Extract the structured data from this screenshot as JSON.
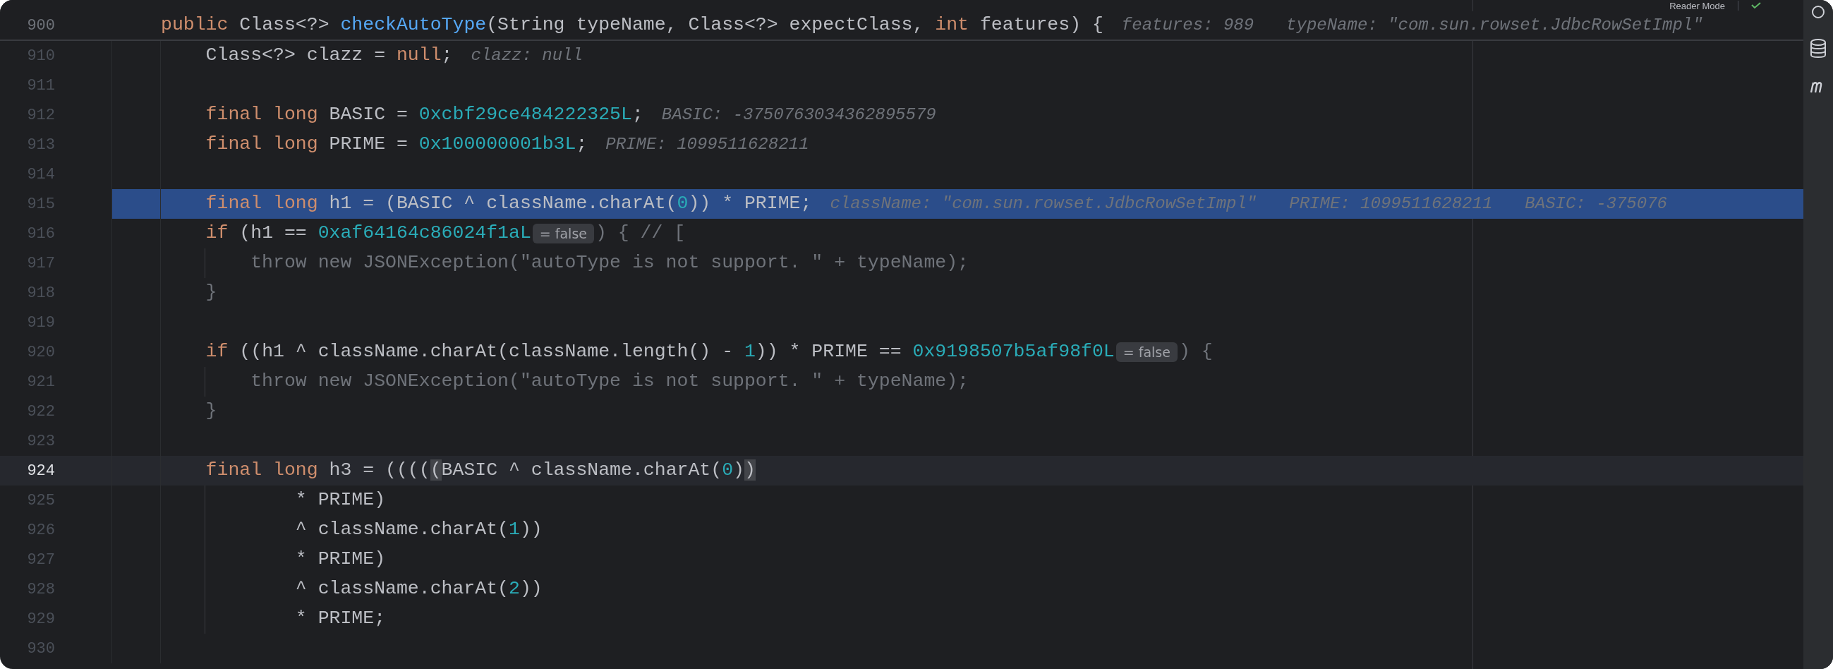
{
  "toolbar": {
    "reader_mode": "Reader Mode"
  },
  "sticky_line": {
    "number": "900",
    "tokens": [
      {
        "kind": "keyword",
        "text": "public"
      },
      {
        "kind": "plain",
        "text": " Class<?> "
      },
      {
        "kind": "function",
        "text": "checkAutoType"
      },
      {
        "kind": "plain",
        "text": "(String typeName, Class<?> expectClass, "
      },
      {
        "kind": "keyword",
        "text": "int"
      },
      {
        "kind": "plain",
        "text": " features) {"
      },
      {
        "kind": "hint",
        "text": "features: 989"
      },
      {
        "kind": "hint",
        "text": "typeName: \"com.sun.rowset.JdbcRowSetImpl\""
      }
    ]
  },
  "lines": [
    {
      "number": "910",
      "selected": false,
      "current": false,
      "guide": false,
      "tokens": [
        {
          "kind": "plain",
          "text": "    Class<?> clazz = "
        },
        {
          "kind": "keyword",
          "text": "null"
        },
        {
          "kind": "plain",
          "text": ";"
        },
        {
          "kind": "hint",
          "text": "clazz: null"
        }
      ]
    },
    {
      "number": "911",
      "selected": false,
      "current": false,
      "guide": false
    },
    {
      "number": "912",
      "selected": false,
      "current": false,
      "guide": false,
      "tokens": [
        {
          "kind": "keyword",
          "text": "    final long"
        },
        {
          "kind": "plain",
          "text": " BASIC = "
        },
        {
          "kind": "number",
          "text": "0xcbf29ce484222325L"
        },
        {
          "kind": "plain",
          "text": ";"
        },
        {
          "kind": "hint",
          "text": "BASIC: -3750763034362895579"
        }
      ]
    },
    {
      "number": "913",
      "selected": false,
      "current": false,
      "guide": false,
      "tokens": [
        {
          "kind": "keyword",
          "text": "    final long"
        },
        {
          "kind": "plain",
          "text": " PRIME = "
        },
        {
          "kind": "number",
          "text": "0x100000001b3L"
        },
        {
          "kind": "plain",
          "text": ";"
        },
        {
          "kind": "hint",
          "text": "PRIME: 1099511628211"
        }
      ]
    },
    {
      "number": "914",
      "selected": false,
      "current": false,
      "guide": false
    },
    {
      "number": "915",
      "selected": true,
      "current": false,
      "guide": false,
      "tokens": [
        {
          "kind": "keyword",
          "text": "    final long"
        },
        {
          "kind": "plain",
          "text": " h1 = (BASIC ^ className.charAt("
        },
        {
          "kind": "number",
          "text": "0"
        },
        {
          "kind": "plain",
          "text": ")) * PRIME;"
        },
        {
          "kind": "hint",
          "text": "className: \"com.sun.rowset.JdbcRowSetImpl\""
        },
        {
          "kind": "hint",
          "text": "PRIME: 1099511628211"
        },
        {
          "kind": "hint",
          "text": "BASIC: -375076"
        }
      ]
    },
    {
      "number": "916",
      "selected": false,
      "current": false,
      "guide": false,
      "tokens": [
        {
          "kind": "keyword",
          "text": "    if"
        },
        {
          "kind": "plain",
          "text": " (h1 == "
        },
        {
          "kind": "number",
          "text": "0xaf64164c86024f1aL"
        },
        {
          "kind": "inlay",
          "text": "= false"
        },
        {
          "kind": "dim",
          "text": ") { // ["
        }
      ]
    },
    {
      "number": "917",
      "selected": false,
      "current": false,
      "guide": true,
      "tokens": [
        {
          "kind": "dim",
          "text": "        throw new JSONException(\"autoType is not support. \" + typeName);"
        }
      ]
    },
    {
      "number": "918",
      "selected": false,
      "current": false,
      "guide": false,
      "tokens": [
        {
          "kind": "dim",
          "text": "    }"
        }
      ]
    },
    {
      "number": "919",
      "selected": false,
      "current": false,
      "guide": false
    },
    {
      "number": "920",
      "selected": false,
      "current": false,
      "guide": false,
      "tokens": [
        {
          "kind": "keyword",
          "text": "    if"
        },
        {
          "kind": "plain",
          "text": " ((h1 ^ className.charAt(className.length() - "
        },
        {
          "kind": "number",
          "text": "1"
        },
        {
          "kind": "plain",
          "text": ")) * PRIME == "
        },
        {
          "kind": "number",
          "text": "0x9198507b5af98f0L"
        },
        {
          "kind": "inlay",
          "text": "= false"
        },
        {
          "kind": "dim",
          "text": ") {"
        }
      ]
    },
    {
      "number": "921",
      "selected": false,
      "current": false,
      "guide": true,
      "tokens": [
        {
          "kind": "dim",
          "text": "        throw new JSONException(\"autoType is not support. \" + typeName);"
        }
      ]
    },
    {
      "number": "922",
      "selected": false,
      "current": false,
      "guide": false,
      "tokens": [
        {
          "kind": "dim",
          "text": "    }"
        }
      ]
    },
    {
      "number": "923",
      "selected": false,
      "current": false,
      "guide": false
    },
    {
      "number": "924",
      "selected": false,
      "current": true,
      "guide": false,
      "tokens": [
        {
          "kind": "keyword",
          "text": "    final long"
        },
        {
          "kind": "plain",
          "text": " h3 = (((("
        },
        {
          "kind": "match",
          "text": "("
        },
        {
          "kind": "plain",
          "text": "BASIC ^ className.charAt("
        },
        {
          "kind": "number",
          "text": "0"
        },
        {
          "kind": "plain",
          "text": ")"
        },
        {
          "kind": "match",
          "text": ")"
        }
      ]
    },
    {
      "number": "925",
      "selected": false,
      "current": false,
      "guide": true,
      "tokens": [
        {
          "kind": "plain",
          "text": "            * PRIME)"
        }
      ]
    },
    {
      "number": "926",
      "selected": false,
      "current": false,
      "guide": true,
      "tokens": [
        {
          "kind": "plain",
          "text": "            ^ className.charAt("
        },
        {
          "kind": "number",
          "text": "1"
        },
        {
          "kind": "plain",
          "text": "))"
        }
      ]
    },
    {
      "number": "927",
      "selected": false,
      "current": false,
      "guide": true,
      "tokens": [
        {
          "kind": "plain",
          "text": "            * PRIME)"
        }
      ]
    },
    {
      "number": "928",
      "selected": false,
      "current": false,
      "guide": true,
      "tokens": [
        {
          "kind": "plain",
          "text": "            ^ className.charAt("
        },
        {
          "kind": "number",
          "text": "2"
        },
        {
          "kind": "plain",
          "text": "))"
        }
      ]
    },
    {
      "number": "929",
      "selected": false,
      "current": false,
      "guide": true,
      "tokens": [
        {
          "kind": "plain",
          "text": "            * PRIME;"
        }
      ]
    },
    {
      "number": "930",
      "selected": false,
      "current": false,
      "guide": false
    }
  ]
}
